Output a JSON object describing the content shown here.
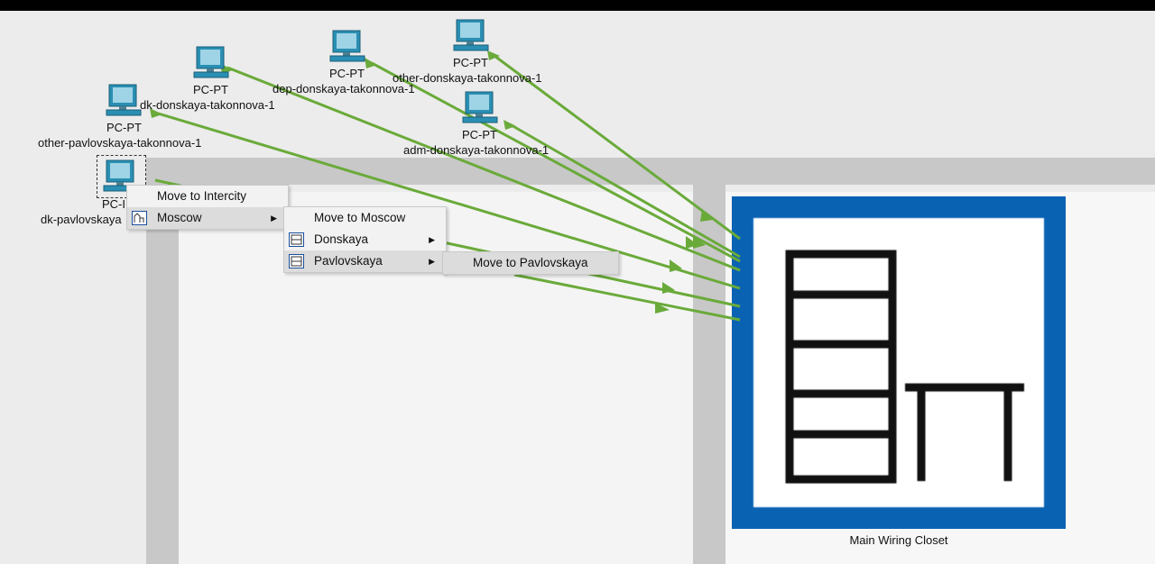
{
  "devices": [
    {
      "id": "pc1",
      "type": "PC-PT",
      "name": "dk-donskaya-takonnova-1"
    },
    {
      "id": "pc2",
      "type": "PC-PT",
      "name": "dep-donskaya-takonnova-1"
    },
    {
      "id": "pc3",
      "type": "PC-PT",
      "name": "other-donskaya-takonnova-1"
    },
    {
      "id": "pc4",
      "type": "PC-PT",
      "name": "adm-donskaya-takonnova-1"
    },
    {
      "id": "pc5",
      "type": "PC-PT",
      "name": "other-pavlovskaya-takonnova-1"
    },
    {
      "id": "pc6",
      "type": "PC-I",
      "name": "dk-pavlovskaya"
    }
  ],
  "closet": {
    "label": "Main Wiring Closet"
  },
  "context_menu": {
    "level1": [
      {
        "label": "Move to Intercity",
        "icon": "none",
        "submenu": false
      },
      {
        "label": "Moscow",
        "icon": "city-icon",
        "submenu": true
      }
    ],
    "level2": [
      {
        "label": "Move to Moscow",
        "icon": "none",
        "submenu": false
      },
      {
        "label": "Donskaya",
        "icon": "building-icon",
        "submenu": true
      },
      {
        "label": "Pavlovskaya",
        "icon": "building-icon",
        "submenu": true
      }
    ],
    "level3": [
      {
        "label": "Move to Pavlovskaya",
        "icon": "none",
        "submenu": false
      }
    ]
  },
  "colors": {
    "link": "#6aaa3a",
    "closet": "#0a62b3",
    "pc": "#2a8fb3"
  }
}
